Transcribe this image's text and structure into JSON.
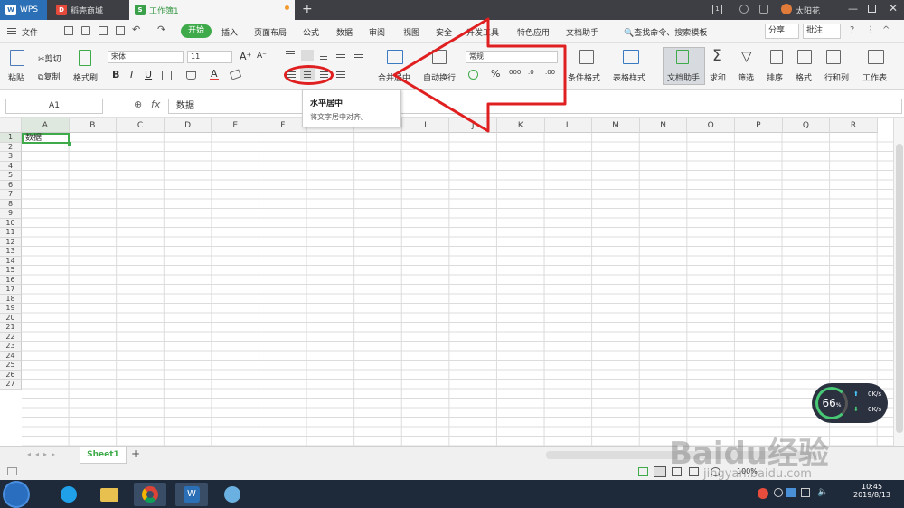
{
  "titlebar": {
    "wps_label": "WPS",
    "tab1": "稻壳商城",
    "tab2": "工作簿1",
    "new_tab": "+",
    "badge": "1",
    "user": "太阳花"
  },
  "menu": {
    "file": "文件",
    "start": "开始",
    "items": [
      "插入",
      "页面布局",
      "公式",
      "数据",
      "审阅",
      "视图",
      "安全",
      "开发工具",
      "特色应用",
      "文档助手"
    ],
    "search": "查找命令、搜索模板",
    "share": "分享",
    "annotate": "批注"
  },
  "ribbon": {
    "paste": "粘贴",
    "cut": "剪切",
    "copy": "复制",
    "format_painter": "格式刷",
    "font": "宋体",
    "size": "11",
    "bold": "B",
    "italic": "I",
    "underline": "U",
    "merge": "合并居中",
    "wrap": "自动换行",
    "number_format": "常规",
    "percent": "%",
    "cond_format": "条件格式",
    "table_style": "表格样式",
    "doc_helper": "文档助手",
    "sum": "求和",
    "filter": "筛选",
    "sort": "排序",
    "fmt": "格式",
    "rowcol": "行和列",
    "worksheet": "工作表"
  },
  "tooltip": {
    "title": "水平居中",
    "desc": "将文字居中对齐。"
  },
  "formula": {
    "cell_ref": "A1",
    "fx": "fx",
    "value": "数据"
  },
  "columns": [
    "A",
    "B",
    "C",
    "D",
    "E",
    "F",
    "G",
    "H",
    "I",
    "J",
    "K",
    "L",
    "M",
    "N",
    "O",
    "P",
    "Q",
    "R"
  ],
  "rows": [
    "1",
    "2",
    "3",
    "4",
    "5",
    "6",
    "7",
    "8",
    "9",
    "10",
    "11",
    "12",
    "13",
    "14",
    "15",
    "16",
    "17",
    "18",
    "19",
    "20",
    "21",
    "22",
    "23",
    "24",
    "25",
    "26",
    "27"
  ],
  "cell_a1": "数据",
  "sheet": {
    "name": "Sheet1",
    "add": "+"
  },
  "status": {
    "zoom": "100%"
  },
  "netmon": {
    "percent": "66",
    "unit": "%",
    "up": "0K/s",
    "down": "0K/s"
  },
  "clock": {
    "time": "10:45",
    "date": "2019/8/13"
  },
  "watermark": "Baidu经验",
  "watermark_url": "jingyan.baidu.com"
}
